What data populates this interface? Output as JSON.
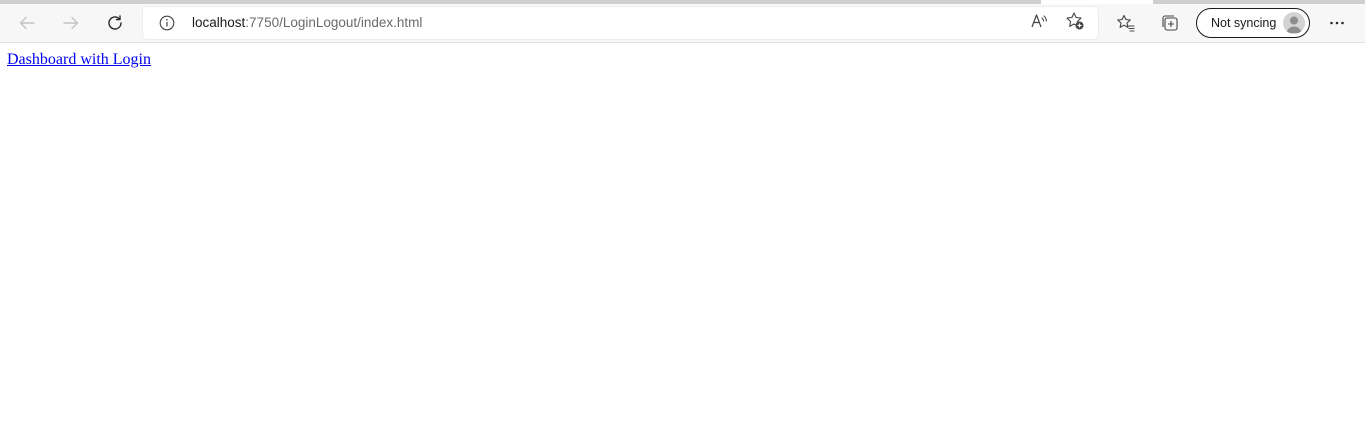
{
  "browser": {
    "address_bar": {
      "host": "localhost",
      "path": ":7750/LoginLogout/index.html"
    },
    "profile": {
      "label": "Not syncing"
    },
    "icons": {
      "back": "back-arrow-icon",
      "forward": "forward-arrow-icon",
      "refresh": "refresh-icon",
      "site_info": "info-icon",
      "read_aloud": "read-aloud-icon",
      "add_favorite": "add-favorite-icon",
      "favorites": "favorites-icon",
      "collections": "collections-icon",
      "avatar": "avatar-icon",
      "more": "more-menu-icon"
    }
  },
  "page": {
    "link_text": "Dashboard with Login",
    "link_color": "#0000ee"
  }
}
